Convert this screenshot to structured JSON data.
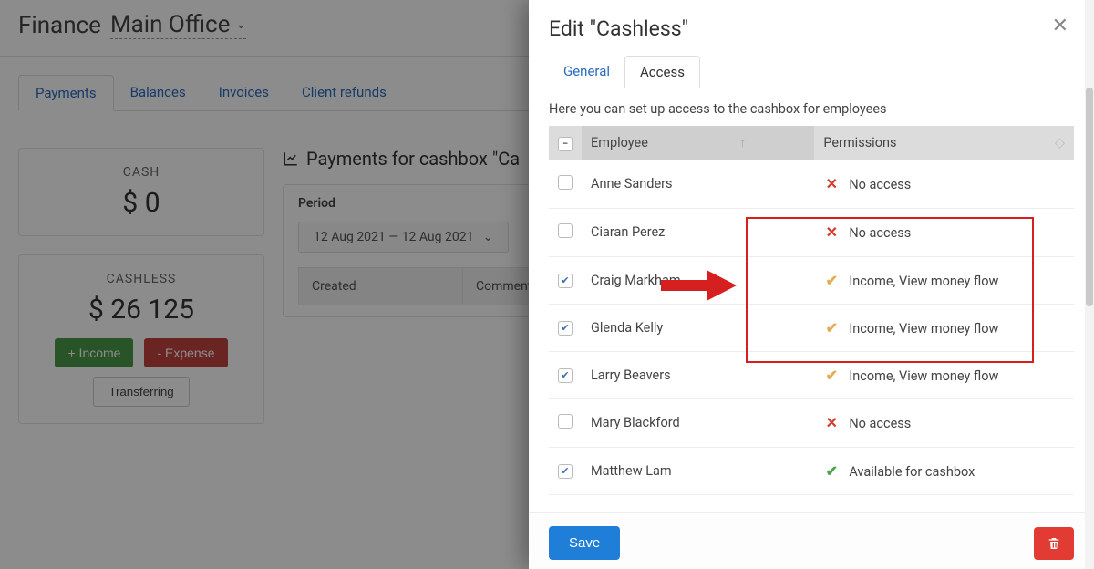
{
  "header": {
    "title": "Finance",
    "location": "Main Office"
  },
  "tabs": [
    "Payments",
    "Balances",
    "Invoices",
    "Client refunds"
  ],
  "active_tab": 0,
  "cashboxes": [
    {
      "name": "CASH",
      "amount": "$ 0"
    },
    {
      "name": "CASHLESS",
      "amount": "$ 26 125"
    }
  ],
  "buttons": {
    "income": "+ Income",
    "expense": "- Expense",
    "transferring": "Transferring"
  },
  "payments": {
    "title": "Payments for cashbox \"Ca",
    "period_label": "Period",
    "period_value": "12 Aug 2021 — 12 Aug 2021",
    "col_created": "Created",
    "col_comment": "Comment"
  },
  "modal": {
    "title": "Edit \"Cashless\"",
    "tabs": [
      "General",
      "Access"
    ],
    "active_tab": 1,
    "help": "Here you can set up access to the cashbox for employees",
    "columns": {
      "employee": "Employee",
      "permissions": "Permissions"
    },
    "rows": [
      {
        "name": "Anne Sanders",
        "checked": false,
        "perm_kind": "no",
        "perm_text": "No access"
      },
      {
        "name": "Ciaran Perez",
        "checked": false,
        "perm_kind": "no",
        "perm_text": "No access"
      },
      {
        "name": "Craig Markham",
        "checked": true,
        "perm_kind": "part",
        "perm_text": "Income, View money flow"
      },
      {
        "name": "Glenda Kelly",
        "checked": true,
        "perm_kind": "part",
        "perm_text": "Income, View money flow"
      },
      {
        "name": "Larry Beavers",
        "checked": true,
        "perm_kind": "part",
        "perm_text": "Income, View money flow"
      },
      {
        "name": "Mary Blackford",
        "checked": false,
        "perm_kind": "no",
        "perm_text": "No access"
      },
      {
        "name": "Matthew Lam",
        "checked": true,
        "perm_kind": "full",
        "perm_text": "Available for cashbox"
      }
    ],
    "save": "Save"
  }
}
